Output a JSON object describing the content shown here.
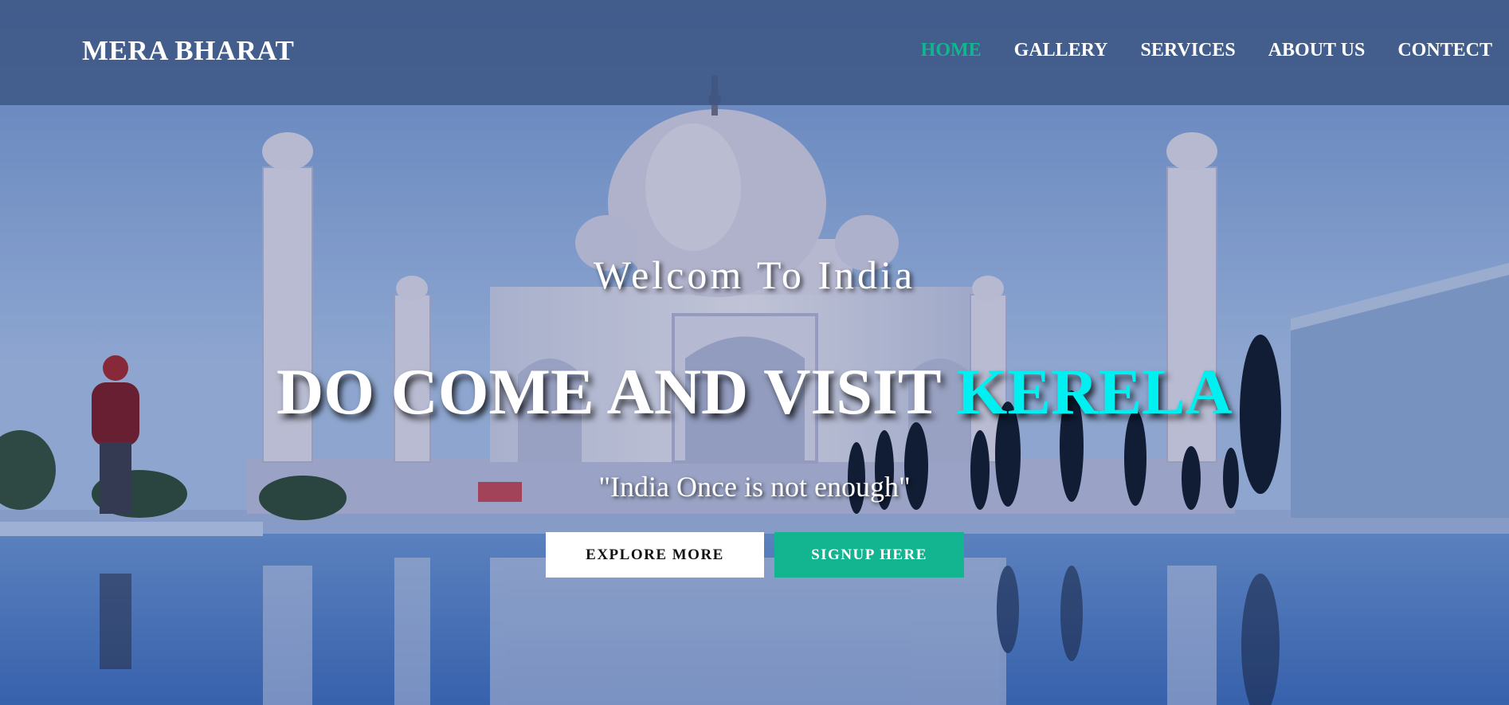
{
  "brand": {
    "name": "MERA BHARAT"
  },
  "nav": {
    "items": [
      {
        "label": "HOME",
        "active": true
      },
      {
        "label": "GALLERY",
        "active": false
      },
      {
        "label": "SERVICES",
        "active": false
      },
      {
        "label": "ABOUT US",
        "active": false
      },
      {
        "label": "CONTECT",
        "active": false
      }
    ]
  },
  "hero": {
    "welcome": "Welcom To India",
    "headline_main": "DO COME AND VISIT ",
    "headline_accent": "KERELA",
    "tagline": "\"India Once is not enough\"",
    "explore_button": "EXPLORE MORE",
    "signup_button": "SIGNUP HERE"
  },
  "colors": {
    "accent_green": "#12b58f",
    "accent_cyan": "#00f0f2",
    "navbar_bg": "#3c5582"
  }
}
